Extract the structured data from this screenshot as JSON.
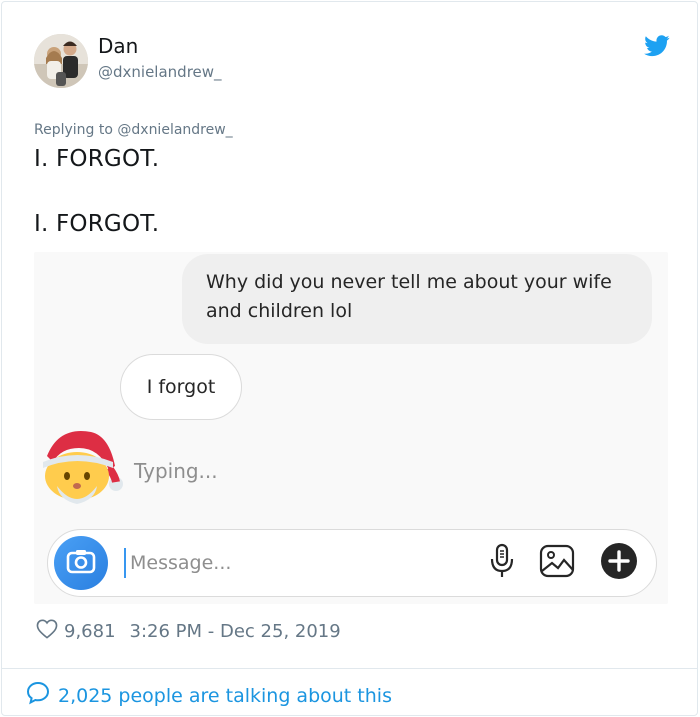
{
  "author": {
    "name": "Dan",
    "handle": "@dxnielandrew_"
  },
  "replying": {
    "prefix": "Replying to",
    "handle": "@dxnielandrew_"
  },
  "tweet": {
    "line1": "I. FORGOT.",
    "line2": "I. FORGOT."
  },
  "chat": {
    "outgoing": "Why did you never tell me about your wife and children lol",
    "incoming": "I forgot",
    "typing": "Typing...",
    "message_placeholder": "Message..."
  },
  "stats": {
    "likes": "9,681",
    "timestamp": "3:26 PM - Dec 25, 2019",
    "talking": "2,025 people are talking about this"
  },
  "colors": {
    "twitter_blue": "#1da1f2",
    "link_blue": "#1b95e0",
    "camera_blue": "#3897f0"
  },
  "icons": [
    "twitter-bird-icon",
    "camera-icon",
    "microphone-icon",
    "image-icon",
    "plus-icon",
    "heart-icon",
    "speech-bubble-icon"
  ]
}
